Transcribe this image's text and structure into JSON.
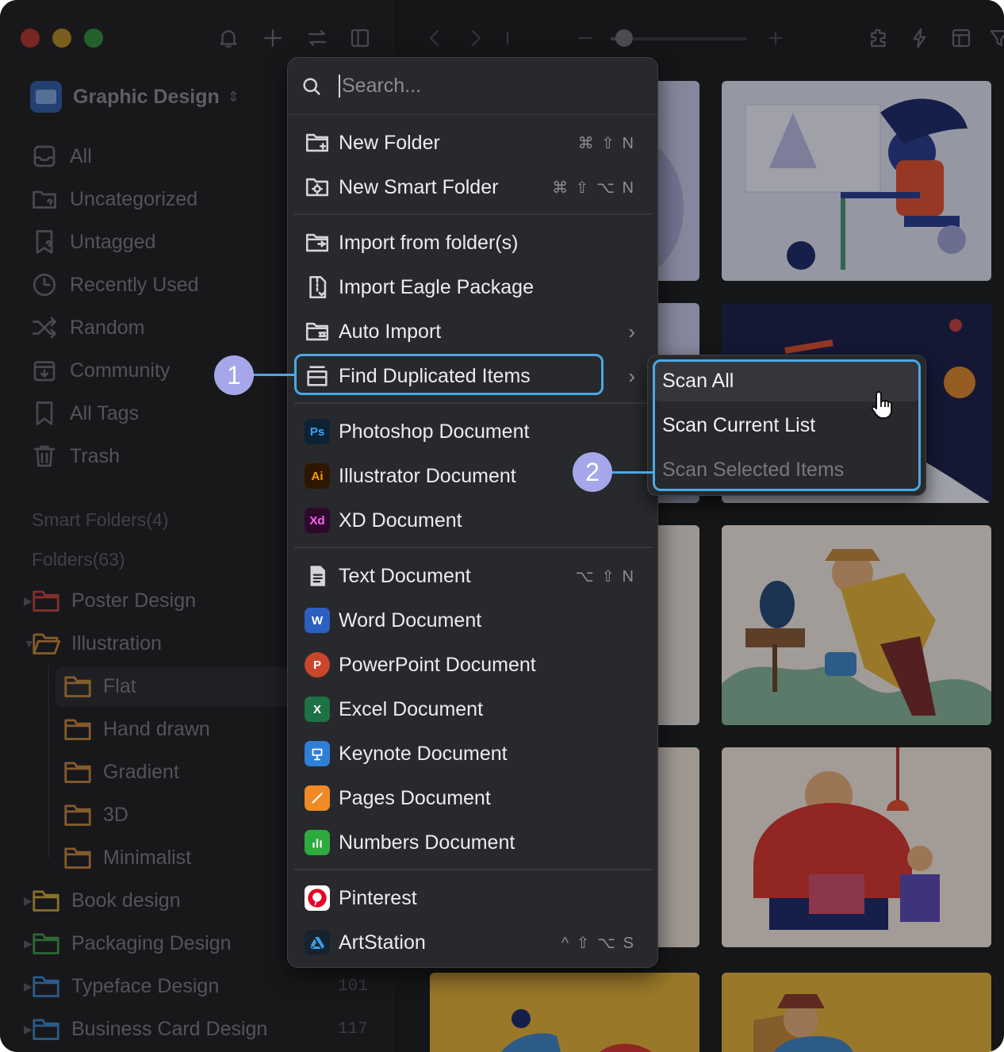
{
  "library": {
    "name": "Graphic Design"
  },
  "nav": [
    {
      "label": "All",
      "icon": "inbox-icon"
    },
    {
      "label": "Uncategorized",
      "icon": "folder-question-icon"
    },
    {
      "label": "Untagged",
      "icon": "tag-question-icon"
    },
    {
      "label": "Recently Used",
      "icon": "clock-icon"
    },
    {
      "label": "Random",
      "icon": "shuffle-icon"
    },
    {
      "label": "Community",
      "icon": "community-icon"
    },
    {
      "label": "All Tags",
      "icon": "bookmark-icon"
    },
    {
      "label": "Trash",
      "icon": "trash-icon"
    }
  ],
  "sections": {
    "smart_folders": "Smart Folders(4)",
    "folders": "Folders(63)"
  },
  "folders": [
    {
      "label": "Poster Design",
      "color": "#c8413f",
      "count": ""
    },
    {
      "label": "Illustration",
      "color": "#c7883c",
      "count": ""
    },
    {
      "label": "Flat",
      "color": "#c7883c",
      "count": ""
    },
    {
      "label": "Hand drawn",
      "color": "#c7883c",
      "count": ""
    },
    {
      "label": "Gradient",
      "color": "#c7883c",
      "count": ""
    },
    {
      "label": "3D",
      "color": "#c7883c",
      "count": ""
    },
    {
      "label": "Minimalist",
      "color": "#c7883c",
      "count": ""
    },
    {
      "label": "Book design",
      "color": "#c9a93a",
      "count": ""
    },
    {
      "label": "Packaging Design",
      "color": "#3f9a4a",
      "count": ""
    },
    {
      "label": "Typeface Design",
      "color": "#3f86c9",
      "count": "101"
    },
    {
      "label": "Business Card Design",
      "color": "#3f86c9",
      "count": "117"
    }
  ],
  "menu": {
    "search_placeholder": "Search...",
    "items": [
      {
        "label": "New Folder",
        "shortcut": "⌘ ⇧ N"
      },
      {
        "label": "New Smart Folder",
        "shortcut": "⌘ ⇧ ⌥ N"
      },
      {
        "label": "Import from folder(s)",
        "shortcut": ""
      },
      {
        "label": "Import Eagle Package",
        "shortcut": ""
      },
      {
        "label": "Auto Import",
        "shortcut": ""
      },
      {
        "label": "Find Duplicated Items",
        "shortcut": ""
      },
      {
        "label": "Photoshop Document",
        "shortcut": ""
      },
      {
        "label": "Illustrator Document",
        "shortcut": ""
      },
      {
        "label": "XD Document",
        "shortcut": ""
      },
      {
        "label": "Text Document",
        "shortcut": "⌥ ⇧ N"
      },
      {
        "label": "Word Document",
        "shortcut": ""
      },
      {
        "label": "PowerPoint Document",
        "shortcut": ""
      },
      {
        "label": "Excel Document",
        "shortcut": ""
      },
      {
        "label": "Keynote Document",
        "shortcut": ""
      },
      {
        "label": "Pages Document",
        "shortcut": ""
      },
      {
        "label": "Numbers Document",
        "shortcut": ""
      },
      {
        "label": "Pinterest",
        "shortcut": ""
      },
      {
        "label": "ArtStation",
        "shortcut": "^ ⇧ ⌥ S"
      }
    ],
    "app_badges": {
      "ps": "Ps",
      "ai": "Ai",
      "xd": "Xd",
      "word": "W",
      "ppt": "P",
      "excel": "X"
    }
  },
  "submenu": {
    "items": [
      {
        "label": "Scan All",
        "enabled": true
      },
      {
        "label": "Scan Current List",
        "enabled": true
      },
      {
        "label": "Scan Selected Items",
        "enabled": false
      }
    ]
  },
  "callouts": {
    "one": "1",
    "two": "2"
  },
  "colors": {
    "accent": "#4aa8e6",
    "badge": "#a6a7ea"
  }
}
